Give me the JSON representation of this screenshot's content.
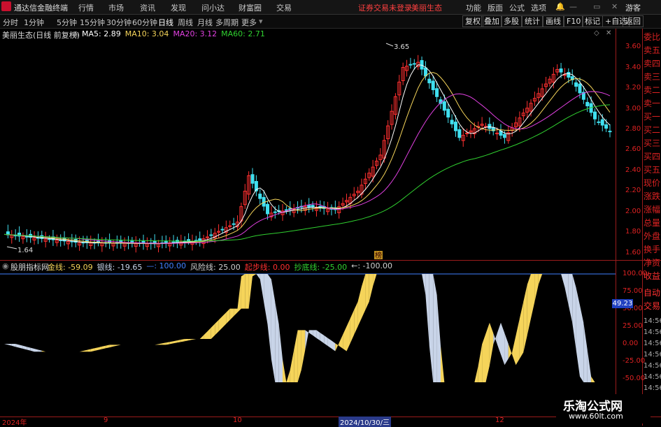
{
  "menubar": {
    "app_title": "通达信金融终端",
    "items": [
      "行情",
      "市场",
      "资讯",
      "发现",
      "问小达",
      "财富圈",
      "交易"
    ],
    "notice": "证券交易未登录",
    "stock": "美丽生态",
    "right_items": [
      "功能",
      "版面",
      "公式",
      "选项"
    ],
    "user": "游客"
  },
  "toolbar": {
    "periods": [
      "分时",
      "1分钟",
      "5分钟",
      "15分钟",
      "30分钟",
      "60分钟",
      "日线",
      "周线",
      "月线",
      "多周期",
      "更多"
    ],
    "active_period": "日线",
    "right_buttons": [
      "复权",
      "叠加",
      "多股",
      "统计",
      "画线",
      "F10",
      "标记",
      "+自选",
      "返回"
    ]
  },
  "main_chart": {
    "title": "美丽生态(日线 前复权)",
    "ma_labels": [
      {
        "text": "MA5: 2.89",
        "color": "#ffffff"
      },
      {
        "text": "MA10: 3.04",
        "color": "#f5d45a"
      },
      {
        "text": "MA20: 3.12",
        "color": "#e040e0"
      },
      {
        "text": "MA60: 2.71",
        "color": "#30d030"
      }
    ],
    "y_ticks": [
      "3.60",
      "3.40",
      "3.20",
      "3.00",
      "2.80",
      "2.60",
      "2.40",
      "2.20",
      "2.00",
      "1.80",
      "1.60"
    ],
    "high_label": "3.65",
    "low_label": "1.64",
    "marker": "榜"
  },
  "sidebar": {
    "items": [
      "委比",
      "卖五",
      "卖四",
      "卖三",
      "卖二",
      "卖一",
      "买一",
      "买二",
      "买三",
      "买四",
      "买五",
      "现价",
      "涨跌",
      "涨幅",
      "总量",
      "外盘",
      "换手",
      "净资",
      "收益"
    ],
    "bottom_items": [
      "自动",
      "交易"
    ]
  },
  "indicator": {
    "title": "股朋指标网",
    "fields": [
      {
        "text": "金线: -59.09",
        "color": "#f5d45a"
      },
      {
        "text": "银线: -19.65",
        "color": "#c8d4e8"
      },
      {
        "text": "—: 100.00",
        "color": "#4080ff"
      },
      {
        "text": "风险线: 25.00",
        "color": "#d0d0d0"
      },
      {
        "text": "起步线: 0.00",
        "color": "#ff3030"
      },
      {
        "text": "抄底线: -25.00",
        "color": "#30d030"
      },
      {
        "text": "←: -100.00",
        "color": "#d0d0d0"
      }
    ],
    "y_ticks": [
      "100.00",
      "75.00",
      "50.00",
      "25.00",
      "0.00",
      "-25.00",
      "-50.00"
    ],
    "current_value": "49.23",
    "time_ticks": [
      "14:56",
      "14:56",
      "14:56",
      "14:56",
      "14:56",
      "14:56",
      "14:56",
      "14:56"
    ]
  },
  "x_axis": {
    "labels": [
      "2024年",
      "9",
      "10",
      "2024/10/30/三",
      "12"
    ]
  },
  "watermark": {
    "text": "乐淘公式网",
    "url": "www.60lt.com"
  },
  "colors": {
    "up": "#ff3030",
    "down": "#40e0f0",
    "gold": "#f5d45a",
    "silver": "#c8d4e8",
    "axis": "#9b1c1c"
  }
}
